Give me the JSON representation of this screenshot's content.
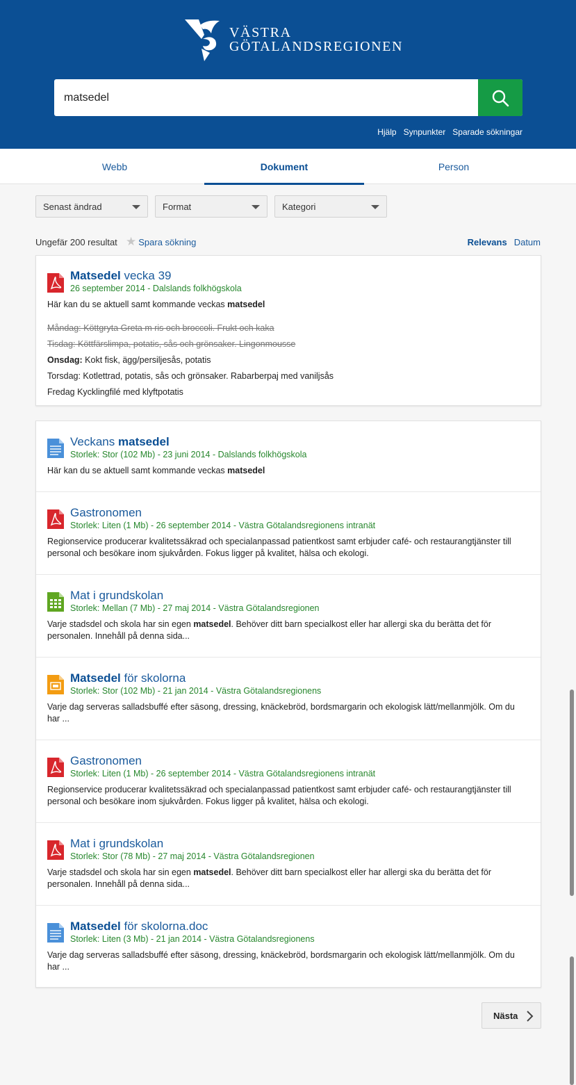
{
  "header": {
    "logo_line1": "VÄSTRA",
    "logo_line2": "GÖTALANDSREGIONEN",
    "search_value": "matsedel",
    "links": [
      "Hjälp",
      "Synpunkter",
      "Sparade sökningar"
    ]
  },
  "tabs": [
    {
      "label": "Webb",
      "active": false
    },
    {
      "label": "Dokument",
      "active": true
    },
    {
      "label": "Person",
      "active": false
    }
  ],
  "filters": [
    "Senast ändrad",
    "Format",
    "Kategori"
  ],
  "results_summary": {
    "count_text": "Ungefär 200 resultat",
    "save_label": "Spara sökning",
    "sort_options": [
      "Relevans",
      "Datum"
    ],
    "active_sort": "Relevans"
  },
  "featured": {
    "icon": "pdf-icon",
    "title_bold": "Matsedel",
    "title_rest": " vecka 39",
    "meta": "26 september 2014 - Dalslands folkhögskola",
    "snippet_pre": "Här kan du se aktuell samt kommande veckas ",
    "snippet_bold": "matsedel",
    "lines": [
      {
        "label": "",
        "text": "Måndag: Köttgryta Greta m ris och broccoli. Frukt och kaka",
        "struck": true
      },
      {
        "label": "",
        "text": "Tisdag: Köttfärslimpa, potatis, sås och grönsaker. Lingonmousse",
        "struck": true
      },
      {
        "label": "Onsdag:",
        "text": " Kokt fisk, ägg/persiljesås, potatis",
        "struck": false
      },
      {
        "label": "",
        "text": "Torsdag: Kotlettrad, potatis, sås och grönsaker. Rabarberpaj med vaniljsås",
        "struck": false
      },
      {
        "label": "",
        "text": "Fredag Kycklingfilé med klyftpotatis",
        "struck": false
      }
    ]
  },
  "results": [
    {
      "icon": "doc-icon",
      "title_pre": "Veckans ",
      "title_bold": "matsedel",
      "title_post": "",
      "meta": "Storlek: Stor (102 Mb) - 23 juni 2014 - Dalslands folkhögskola",
      "snippet_pre": "Här kan du se aktuell samt kommande veckas ",
      "snippet_bold": "matsedel",
      "snippet_post": ""
    },
    {
      "icon": "pdf-icon",
      "title_pre": "Gastronomen",
      "title_bold": "",
      "title_post": "",
      "meta": "Storlek: Liten (1 Mb) - 26 september 2014 - Västra Götalandsregionens intranät",
      "snippet_pre": "Regionservice producerar kvalitetssäkrad och specialanpassad patientkost samt erbjuder café- och restaurangtjänster till personal och besökare inom sjukvården. Fokus ligger på kvalitet, hälsa och ekologi.",
      "snippet_bold": "",
      "snippet_post": ""
    },
    {
      "icon": "spreadsheet-icon",
      "title_pre": "Mat i grundskolan",
      "title_bold": "",
      "title_post": "",
      "meta": "Storlek: Mellan (7 Mb) - 27 maj 2014 - Västra Götalandsregionen",
      "snippet_pre": "Varje stadsdel och skola har sin egen ",
      "snippet_bold": "matsedel",
      "snippet_post": ". Behöver ditt barn specialkost eller har allergi ska du berätta det för personalen. Innehåll på denna sida..."
    },
    {
      "icon": "presentation-icon",
      "title_pre": "",
      "title_bold": "Matsedel",
      "title_post": " för skolorna",
      "meta": "Storlek: Stor (102 Mb) - 21 jan 2014 - Västra Götalandsregionens",
      "snippet_pre": "Varje dag serveras salladsbuffé efter säsong, dressing, knäckebröd, bordsmargarin och ekologisk lätt/mellanmjölk. Om du har ...",
      "snippet_bold": "",
      "snippet_post": ""
    },
    {
      "icon": "pdf-icon",
      "title_pre": "Gastronomen",
      "title_bold": "",
      "title_post": "",
      "meta": "Storlek: Liten (1 Mb) - 26 september 2014 - Västra Götalandsregionens intranät",
      "snippet_pre": "Regionservice producerar kvalitetssäkrad och specialanpassad patientkost samt erbjuder café- och restaurangtjänster till personal och besökare inom sjukvården. Fokus ligger på kvalitet, hälsa och ekologi.",
      "snippet_bold": "",
      "snippet_post": ""
    },
    {
      "icon": "pdf-icon",
      "title_pre": "Mat i grundskolan",
      "title_bold": "",
      "title_post": "",
      "meta": "Storlek: Stor (78 Mb) - 27 maj 2014 - Västra Götalandsregionen",
      "snippet_pre": "Varje stadsdel och skola har sin egen ",
      "snippet_bold": "matsedel",
      "snippet_post": ". Behöver ditt barn specialkost eller har allergi ska du berätta det för personalen. Innehåll på denna sida..."
    },
    {
      "icon": "doc-icon",
      "title_pre": "",
      "title_bold": "Matsedel",
      "title_post": " för skolorna.doc",
      "meta": "Storlek: Liten (3 Mb) - 21 jan 2014 - Västra Götalandsregionens",
      "snippet_pre": "Varje dag serveras salladsbuffé efter säsong, dressing, knäckebröd, bordsmargarin och ekologisk lätt/mellanmjölk. Om du har ...",
      "snippet_bold": "",
      "snippet_post": ""
    }
  ],
  "pagination": {
    "next_label": "Nästa"
  },
  "colors": {
    "brand_blue": "#0b4f94",
    "search_green": "#159b45",
    "meta_green": "#27872d",
    "link_blue": "#1a5a9c"
  }
}
